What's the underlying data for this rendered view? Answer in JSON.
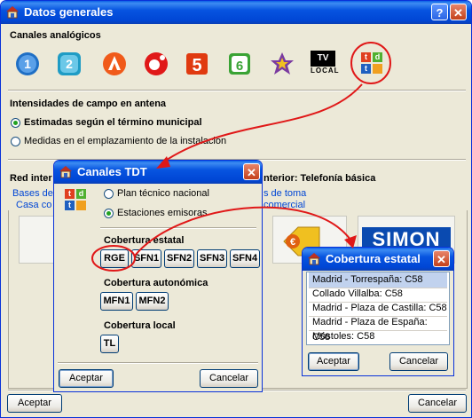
{
  "main": {
    "title": "Datos generales",
    "help_label": "?",
    "close_label": "✕",
    "analog_label": "Canales analógicos",
    "channels": [
      {
        "name": "1",
        "color": "#1f6fc5"
      },
      {
        "name": "2",
        "color": "#1f9cc5"
      },
      {
        "name": "antena3",
        "color": "#f05a1a"
      },
      {
        "name": "cuatro",
        "color": "#e01818"
      },
      {
        "name": "5",
        "color": "#e03a10"
      },
      {
        "name": "6",
        "color": "#3aa335"
      },
      {
        "name": "star",
        "color": "#7a3aa0"
      },
      {
        "name": "TV LOCAL",
        "color": "#000000"
      }
    ],
    "tv_local_top": "TV",
    "tv_local_bottom": "LOCAL",
    "intensidades_label": "Intensidades de campo en antena",
    "radio_estimadas": "Estimadas según el término municipal",
    "radio_medidas": "Medidas en el emplazamiento de la instalación",
    "red_label": "Red inter",
    "telefonia_label": "nterior: Telefonía básica",
    "bases_label": "Bases de",
    "casa_label": "Casa co",
    "toma_label": "s de toma",
    "comercial_label": "comercial",
    "brand_label": "SIMON",
    "accept_label": "Aceptar",
    "cancel_label": "Cancelar"
  },
  "tdt_dialog": {
    "title": "Canales TDT",
    "close_label": "✕",
    "radio_plan": "Plan técnico nacional",
    "radio_estaciones": "Estaciones emisoras",
    "estatal_label": "Cobertura estatal",
    "estatal_items": [
      "RGE",
      "SFN1",
      "SFN2",
      "SFN3",
      "SFN4"
    ],
    "autonomica_label": "Cobertura autonómica",
    "autonomica_items": [
      "MFN1",
      "MFN2"
    ],
    "local_label": "Cobertura local",
    "local_items": [
      "TL"
    ],
    "accept_label": "Aceptar",
    "cancel_label": "Cancelar"
  },
  "estatal_dialog": {
    "title": "Cobertura estatal",
    "close_label": "✕",
    "rows": [
      "Madrid - Torrespaña: C58",
      "Collado Villalba: C58",
      "Madrid - Plaza de Castilla: C58",
      "Madrid - Plaza de España: C58",
      "Móstoles: C58"
    ],
    "accept_label": "Aceptar",
    "cancel_label": "Cancelar"
  },
  "colors": {
    "title_bar": "#0054e3",
    "highlight_red": "#e01818",
    "tdt_t": "#e04020",
    "tdt_d": "#50b030",
    "tdt_t2": "#2060c0"
  }
}
